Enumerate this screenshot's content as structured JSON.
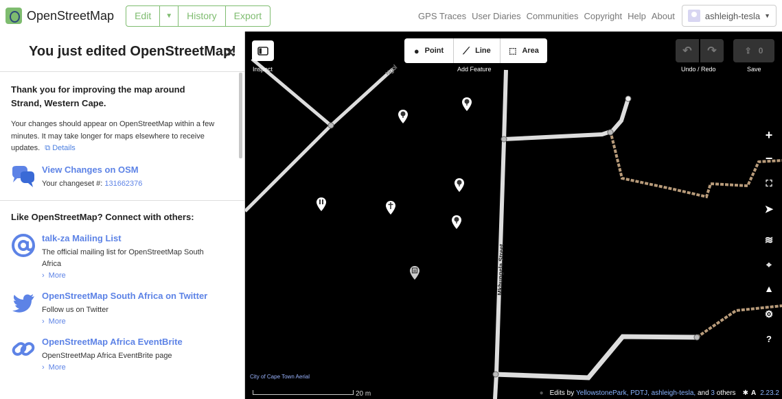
{
  "topbar": {
    "brand": "OpenStreetMap",
    "edit_label": "Edit",
    "history_label": "History",
    "export_label": "Export",
    "nav_links": [
      "GPS Traces",
      "User Diaries",
      "Communities",
      "Copyright",
      "Help",
      "About"
    ],
    "user_name": "ashleigh-tesla"
  },
  "sidebar": {
    "title": "You just edited OpenStreetMap!",
    "thanks": "Thank you for improving the map around Strand, Western Cape.",
    "note": "Your changes should appear on OpenStreetMap within a few minutes. It may take longer for maps elsewhere to receive updates.",
    "details_label": "Details",
    "view_changes": {
      "title": "View Changes on OSM",
      "prefix": "Your changeset #:",
      "changeset": "131662376"
    },
    "connect_title": "Like OpenStreetMap? Connect with others:",
    "communities": [
      {
        "title": "talk-za Mailing List",
        "desc": "The official mailing list for OpenStreetMap South Africa",
        "more": "More"
      },
      {
        "title": "OpenStreetMap South Africa on Twitter",
        "desc": "Follow us on Twitter",
        "more": "More"
      },
      {
        "title": "OpenStreetMap Africa EventBrite",
        "desc": "OpenStreetMap Africa EventBrite page",
        "more": "More"
      }
    ]
  },
  "map": {
    "inspect_label": "Inspect",
    "add_feature_label": "Add Feature",
    "point_label": "Point",
    "line_label": "Line",
    "area_label": "Area",
    "undo_redo_label": "Undo / Redo",
    "save_label": "Save",
    "save_count": "0",
    "road_label_1": "Ngol",
    "road_label_2": "Mkhungela Street",
    "imagery_attribution": "City of Cape Town Aerial",
    "scale_label": "20 m",
    "footer": {
      "edits_by": "Edits by",
      "users": "YellowstonePark, PDTJ, ashleigh-tesla,",
      "and": "and",
      "others_count": "3",
      "others": "others",
      "version": "2.23.2"
    }
  }
}
